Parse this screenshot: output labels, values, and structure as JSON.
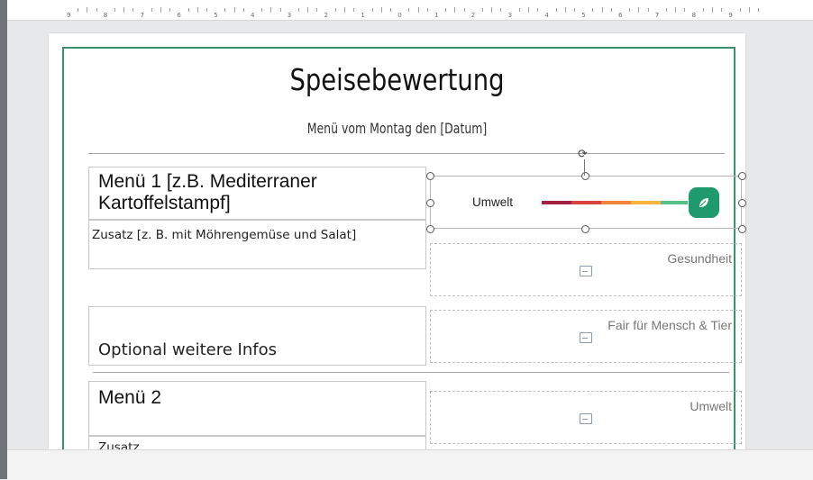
{
  "ruler": {
    "labels": [
      "9",
      "8",
      "7",
      "6",
      "5",
      "4",
      "3",
      "2",
      "1",
      "0",
      "1",
      "2",
      "3",
      "4",
      "5",
      "6",
      "7",
      "8",
      "9"
    ]
  },
  "document": {
    "title": "Speisebewertung",
    "subtitle": "Menü vom Montag den [Datum]",
    "menu1": {
      "title": "Menü 1 [z.B. Mediterraner Kartoffelstampf]",
      "addon": "Zusatz [z. B. mit Möhrengemüse und Salat]",
      "optional": "Optional weitere Infos"
    },
    "menu2": {
      "title": "Menü 2",
      "addon": "Zusatz"
    },
    "ratings": {
      "selected_label": "Umwelt",
      "health": "Gesundheit",
      "fair": "Fair für Mensch & Tier",
      "environment": "Umwelt"
    }
  },
  "colors": {
    "accent_border": "#3e8f6c",
    "scale": [
      "#a3203f",
      "#d9433f",
      "#f0843a",
      "#f7b440",
      "#59c083"
    ],
    "badge": "#1f9a6c"
  },
  "icons": {
    "badge": "leaf-icon",
    "placeholder": "image-placeholder-icon",
    "rotate": "rotate-handle-icon"
  }
}
